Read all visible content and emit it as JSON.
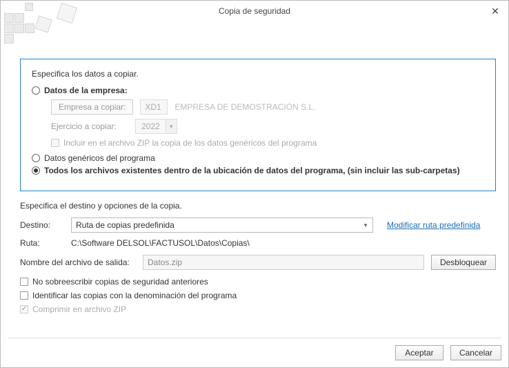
{
  "window": {
    "title": "Copia de seguridad"
  },
  "section1": {
    "heading": "Especifica los datos a copiar.",
    "opt_company": "Datos de la empresa:",
    "company_btn": "Empresa a copiar:",
    "company_code": "XD1",
    "company_name": "EMPRESA DE DEMOSTRACIÓN S.L.",
    "year_label": "Ejercicio a copiar:",
    "year_value": "2022",
    "include_generic": "Incluir en el archivo ZIP la copia de los datos genéricos del programa",
    "opt_generic": "Datos genéricos del programa",
    "opt_all": "Todos los archivos existentes dentro de la ubicación de datos del programa, (sin incluir las sub-carpetas)"
  },
  "section2": {
    "heading": "Especifica el destino y opciones de la copia.",
    "dest_label": "Destino:",
    "dest_value": "Ruta de copias predefinida",
    "modify_link": "Modificar ruta predefinida",
    "path_label": "Ruta:",
    "path_value": "C:\\Software DELSOL\\FACTUSOL\\Datos\\Copias\\",
    "output_label": "Nombre del archivo de salida:",
    "output_value": "Datos.zip",
    "unlock_btn": "Desbloquear",
    "chk_no_overwrite": "No sobreescribir copias de seguridad anteriores",
    "chk_identify": "Identificar las copias con la denominación del programa",
    "chk_compress": "Comprimir en archivo ZIP"
  },
  "footer": {
    "accept": "Aceptar",
    "cancel": "Cancelar"
  }
}
